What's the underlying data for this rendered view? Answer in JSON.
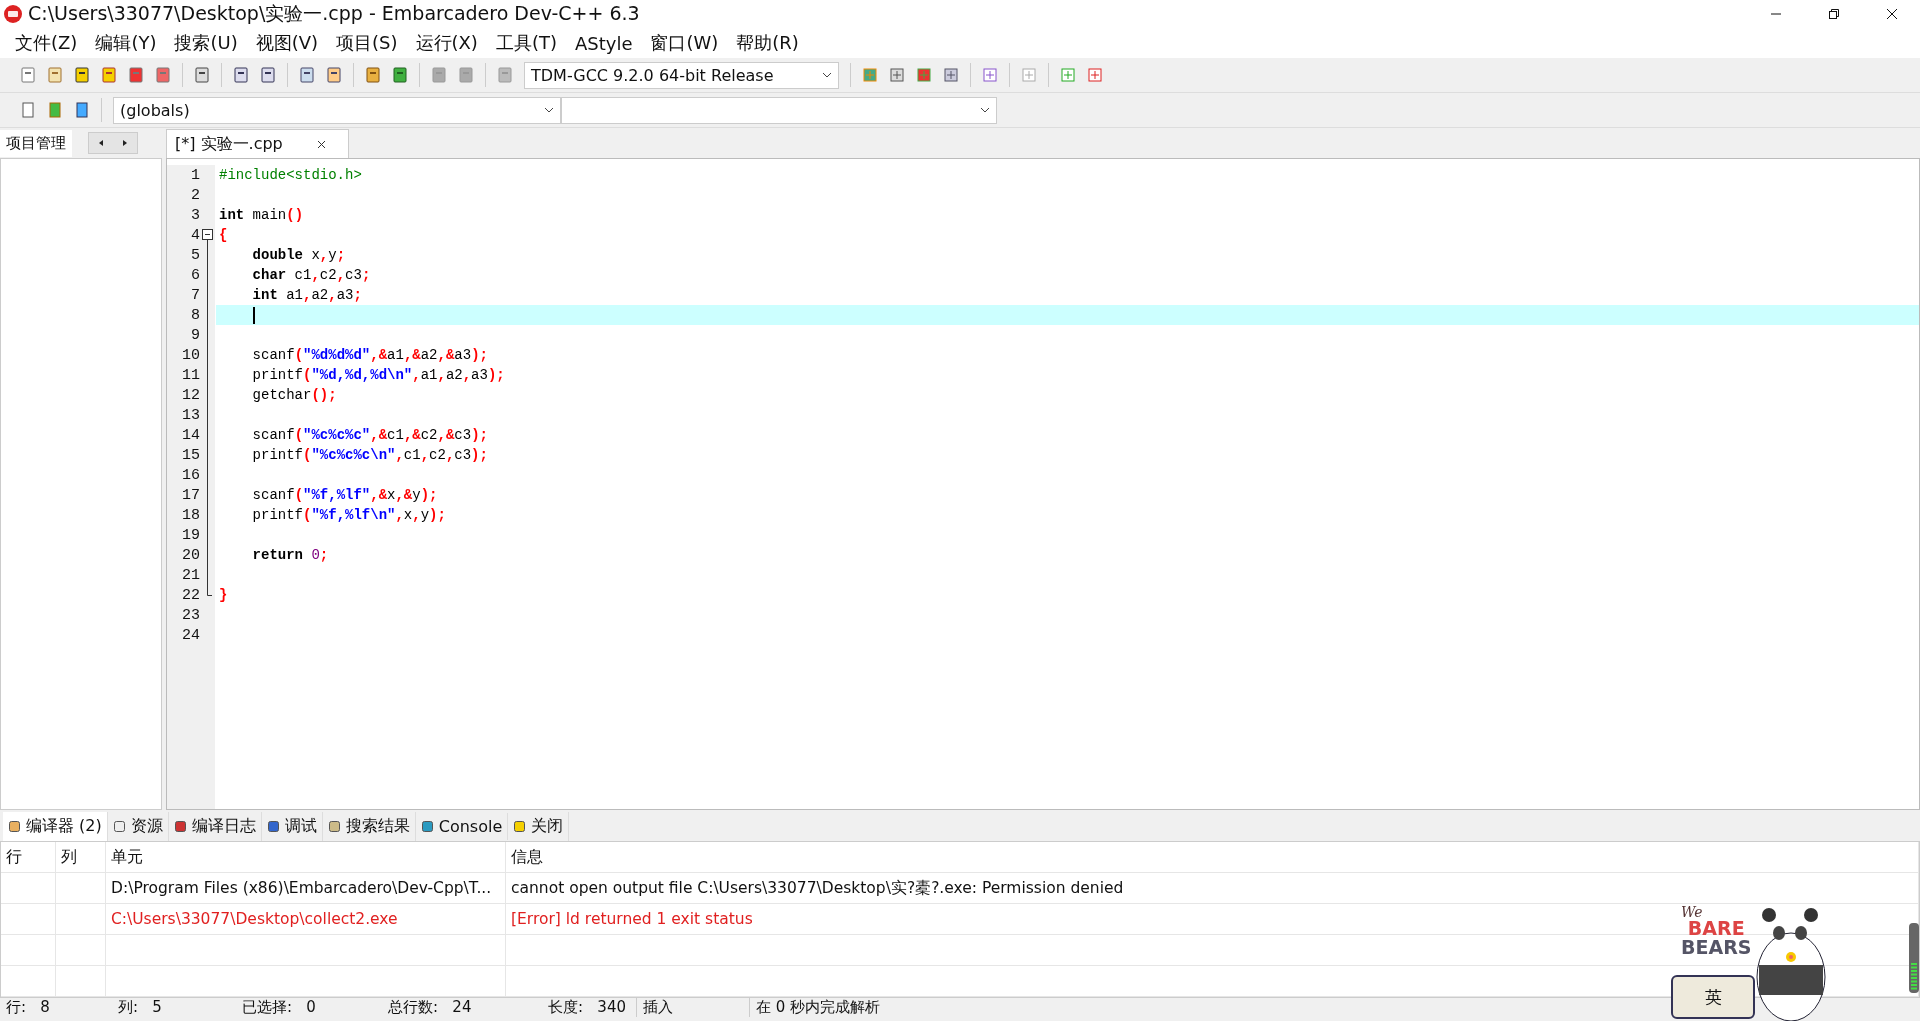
{
  "window": {
    "title": "C:\\Users\\33077\\Desktop\\实验一.cpp - Embarcadero Dev-C++ 6.3"
  },
  "menu": [
    "文件(Z)",
    "编辑(Y)",
    "搜索(U)",
    "视图(V)",
    "项目(S)",
    "运行(X)",
    "工具(T)",
    "AStyle",
    "窗口(W)",
    "帮助(R)"
  ],
  "compiler_select": {
    "value": "TDM-GCC 9.2.0 64-bit Release"
  },
  "class_select": {
    "value": "(globals)"
  },
  "left_panel": {
    "tabs": [
      {
        "label": "项目管理",
        "selected": true
      }
    ]
  },
  "editor_tabs": [
    {
      "label": "[*] 实验一.cpp",
      "selected": true
    }
  ],
  "code": [
    {
      "number": "1",
      "kind": "code",
      "current": false,
      "tokens": [
        {
          "kind": "preprocessor",
          "t": "#include<stdio.h>"
        }
      ]
    },
    {
      "number": "2",
      "kind": "code",
      "current": false
    },
    {
      "number": "3",
      "kind": "code",
      "current": false,
      "tokens": [
        {
          "kind": "keyword",
          "t": "int"
        },
        {
          "kind": "plain",
          "t": " main"
        },
        {
          "kind": "symbol",
          "t": "()"
        }
      ]
    },
    {
      "number": "4",
      "kind": "fold_start",
      "current": false,
      "tokens": [
        {
          "kind": "symbol",
          "t": "{"
        }
      ]
    },
    {
      "number": "5",
      "kind": "code",
      "current": false,
      "tokens": [
        {
          "kind": "keyword",
          "t": "    double"
        },
        {
          "kind": "plain",
          "t": " x"
        },
        {
          "kind": "symbol",
          "t": ","
        },
        {
          "kind": "plain",
          "t": "y"
        },
        {
          "kind": "symbol",
          "t": ";"
        }
      ]
    },
    {
      "number": "6",
      "kind": "code",
      "current": false,
      "tokens": [
        {
          "kind": "keyword",
          "t": "    char"
        },
        {
          "kind": "plain",
          "t": " c1"
        },
        {
          "kind": "symbol",
          "t": ","
        },
        {
          "kind": "plain",
          "t": "c2"
        },
        {
          "kind": "symbol",
          "t": ","
        },
        {
          "kind": "plain",
          "t": "c3"
        },
        {
          "kind": "symbol",
          "t": ";"
        }
      ]
    },
    {
      "number": "7",
      "kind": "code",
      "current": false,
      "tokens": [
        {
          "kind": "keyword",
          "t": "    int"
        },
        {
          "kind": "plain",
          "t": " a1"
        },
        {
          "kind": "symbol",
          "t": ","
        },
        {
          "kind": "plain",
          "t": "a2"
        },
        {
          "kind": "symbol",
          "t": ","
        },
        {
          "kind": "plain",
          "t": "a3"
        },
        {
          "kind": "symbol",
          "t": ";"
        }
      ]
    },
    {
      "number": "8",
      "kind": "code",
      "current": true
    },
    {
      "number": "9",
      "kind": "code",
      "current": false
    },
    {
      "number": "10",
      "kind": "code",
      "current": false,
      "tokens": [
        {
          "kind": "plain",
          "t": "    scanf"
        },
        {
          "kind": "symbol",
          "t": "("
        },
        {
          "kind": "string",
          "t": "\"%d%d%d\""
        },
        {
          "kind": "symbol",
          "t": ",&"
        },
        {
          "kind": "plain",
          "t": "a1"
        },
        {
          "kind": "symbol",
          "t": ",&"
        },
        {
          "kind": "plain",
          "t": "a2"
        },
        {
          "kind": "symbol",
          "t": ",&"
        },
        {
          "kind": "plain",
          "t": "a3"
        },
        {
          "kind": "symbol",
          "t": ");"
        }
      ]
    },
    {
      "number": "11",
      "kind": "code",
      "current": false,
      "tokens": [
        {
          "kind": "plain",
          "t": "    printf"
        },
        {
          "kind": "symbol",
          "t": "("
        },
        {
          "kind": "string",
          "t": "\"%d,%d,%d\\n\""
        },
        {
          "kind": "symbol",
          "t": ","
        },
        {
          "kind": "plain",
          "t": "a1"
        },
        {
          "kind": "symbol",
          "t": ","
        },
        {
          "kind": "plain",
          "t": "a2"
        },
        {
          "kind": "symbol",
          "t": ","
        },
        {
          "kind": "plain",
          "t": "a3"
        },
        {
          "kind": "symbol",
          "t": ");"
        }
      ]
    },
    {
      "number": "12",
      "kind": "code",
      "current": false,
      "tokens": [
        {
          "kind": "plain",
          "t": "    getchar"
        },
        {
          "kind": "symbol",
          "t": "();"
        }
      ]
    },
    {
      "number": "13",
      "kind": "code",
      "current": false
    },
    {
      "number": "14",
      "kind": "code",
      "current": false,
      "tokens": [
        {
          "kind": "plain",
          "t": "    scanf"
        },
        {
          "kind": "symbol",
          "t": "("
        },
        {
          "kind": "string",
          "t": "\"%c%c%c\""
        },
        {
          "kind": "symbol",
          "t": ",&"
        },
        {
          "kind": "plain",
          "t": "c1"
        },
        {
          "kind": "symbol",
          "t": ",&"
        },
        {
          "kind": "plain",
          "t": "c2"
        },
        {
          "kind": "symbol",
          "t": ",&"
        },
        {
          "kind": "plain",
          "t": "c3"
        },
        {
          "kind": "symbol",
          "t": ");"
        }
      ]
    },
    {
      "number": "15",
      "kind": "code",
      "current": false,
      "tokens": [
        {
          "kind": "plain",
          "t": "    printf"
        },
        {
          "kind": "symbol",
          "t": "("
        },
        {
          "kind": "string",
          "t": "\"%c%c%c\\n\""
        },
        {
          "kind": "symbol",
          "t": ","
        },
        {
          "kind": "plain",
          "t": "c1"
        },
        {
          "kind": "symbol",
          "t": ","
        },
        {
          "kind": "plain",
          "t": "c2"
        },
        {
          "kind": "symbol",
          "t": ","
        },
        {
          "kind": "plain",
          "t": "c3"
        },
        {
          "kind": "symbol",
          "t": ");"
        }
      ]
    },
    {
      "number": "16",
      "kind": "code",
      "current": false
    },
    {
      "number": "17",
      "kind": "code",
      "current": false,
      "tokens": [
        {
          "kind": "plain",
          "t": "    scanf"
        },
        {
          "kind": "symbol",
          "t": "("
        },
        {
          "kind": "string",
          "t": "\"%f,%lf\""
        },
        {
          "kind": "symbol",
          "t": ",&"
        },
        {
          "kind": "plain",
          "t": "x"
        },
        {
          "kind": "symbol",
          "t": ",&"
        },
        {
          "kind": "plain",
          "t": "y"
        },
        {
          "kind": "symbol",
          "t": ");"
        }
      ]
    },
    {
      "number": "18",
      "kind": "code",
      "current": false,
      "tokens": [
        {
          "kind": "plain",
          "t": "    printf"
        },
        {
          "kind": "symbol",
          "t": "("
        },
        {
          "kind": "string",
          "t": "\"%f,%lf\\n\""
        },
        {
          "kind": "symbol",
          "t": ","
        },
        {
          "kind": "plain",
          "t": "x"
        },
        {
          "kind": "symbol",
          "t": ","
        },
        {
          "kind": "plain",
          "t": "y"
        },
        {
          "kind": "symbol",
          "t": ");"
        }
      ]
    },
    {
      "number": "19",
      "kind": "code",
      "current": false
    },
    {
      "number": "20",
      "kind": "code",
      "current": false,
      "tokens": [
        {
          "kind": "keyword",
          "t": "    return "
        },
        {
          "kind": "number",
          "t": "0"
        },
        {
          "kind": "symbol",
          "t": ";"
        }
      ]
    },
    {
      "number": "21",
      "kind": "code",
      "current": false
    },
    {
      "number": "22",
      "kind": "fold_end",
      "current": false,
      "tokens": [
        {
          "kind": "symbol",
          "t": "}"
        }
      ]
    },
    {
      "number": "23",
      "kind": "code",
      "current": false
    },
    {
      "number": "24",
      "kind": "code",
      "current": false
    }
  ],
  "bottom_tabs": [
    {
      "label": "编译器 (2)",
      "selected": true
    },
    {
      "label": "资源",
      "selected": false
    },
    {
      "label": "编译日志",
      "selected": false
    },
    {
      "label": "调试",
      "selected": false
    },
    {
      "label": "搜索结果",
      "selected": false
    },
    {
      "label": "Console",
      "selected": false
    },
    {
      "label": "关闭",
      "selected": false
    }
  ],
  "messages": {
    "columns": [
      "行",
      "列",
      "单元",
      "信息"
    ],
    "rows": [
      {
        "kind": "note",
        "unit": "D:\\Program Files (x86)\\Embarcadero\\Dev-Cpp\\T...",
        "message": "cannot open output file C:\\Users\\33077\\Desktop\\实?橐?.exe: Permission denied"
      },
      {
        "kind": "error",
        "unit": "C:\\Users\\33077\\Desktop\\collect2.exe",
        "message": "[Error] ld returned 1 exit status"
      }
    ]
  },
  "ime_widget": {
    "logo_top": "We",
    "logo_mid": "BARE",
    "logo_bottom": "BEARS",
    "mode": "英"
  },
  "status_bar": [
    {
      "label": "行:",
      "value": "8"
    },
    {
      "label": "列:",
      "value": "5"
    },
    {
      "label": "已选择:",
      "value": "0"
    },
    {
      "label": "总行数:",
      "value": "24"
    },
    {
      "label": "长度:",
      "value": "340"
    },
    {
      "label": "插入"
    },
    {
      "label": "在 0 秒内完成解析"
    }
  ]
}
